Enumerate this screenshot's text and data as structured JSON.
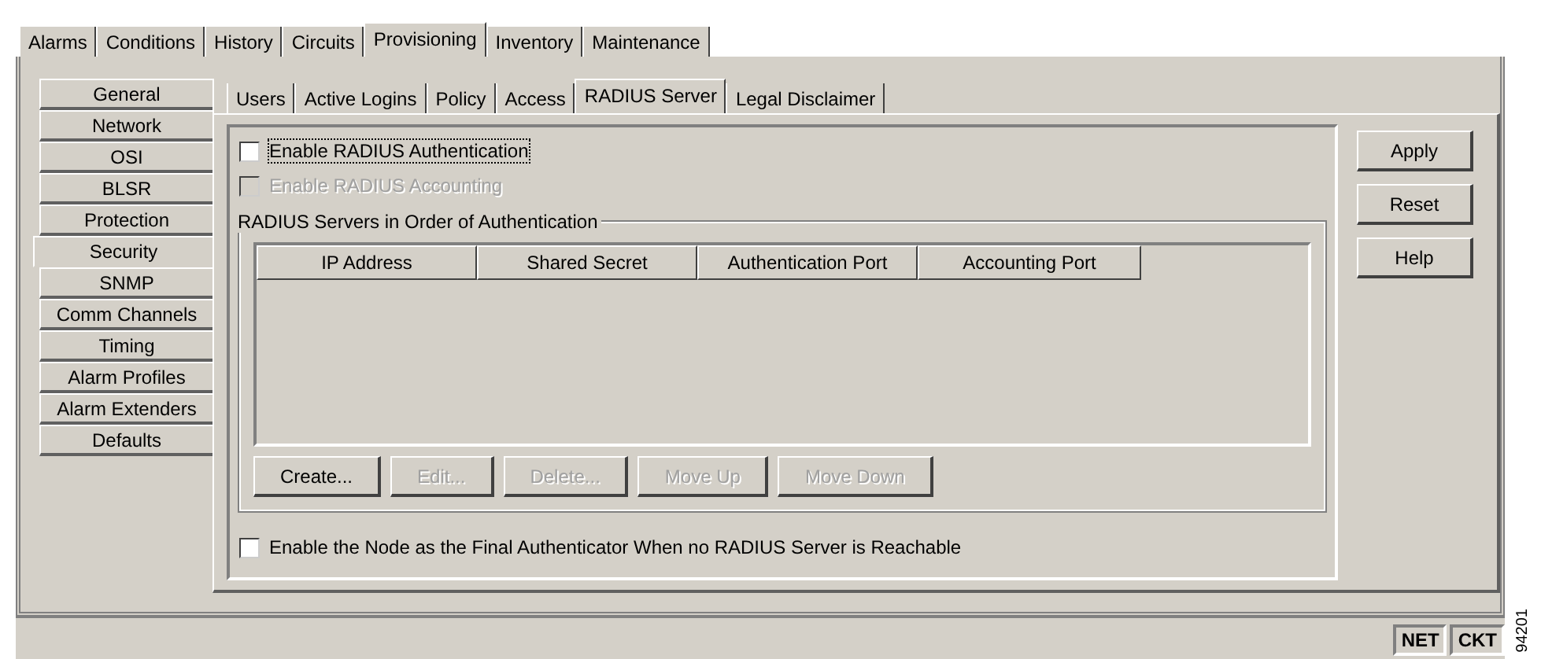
{
  "tabs": [
    {
      "label": "Alarms",
      "selected": false
    },
    {
      "label": "Conditions",
      "selected": false
    },
    {
      "label": "History",
      "selected": false
    },
    {
      "label": "Circuits",
      "selected": false
    },
    {
      "label": "Provisioning",
      "selected": true
    },
    {
      "label": "Inventory",
      "selected": false
    },
    {
      "label": "Maintenance",
      "selected": false
    }
  ],
  "sidebar": {
    "items": [
      {
        "label": "General",
        "selected": false
      },
      {
        "label": "Network",
        "selected": false
      },
      {
        "label": "OSI",
        "selected": false
      },
      {
        "label": "BLSR",
        "selected": false
      },
      {
        "label": "Protection",
        "selected": false
      },
      {
        "label": "Security",
        "selected": true
      },
      {
        "label": "SNMP",
        "selected": false
      },
      {
        "label": "Comm Channels",
        "selected": false
      },
      {
        "label": "Timing",
        "selected": false
      },
      {
        "label": "Alarm Profiles",
        "selected": false
      },
      {
        "label": "Alarm Extenders",
        "selected": false
      },
      {
        "label": "Defaults",
        "selected": false
      }
    ]
  },
  "subtabs": [
    {
      "label": "Users",
      "selected": false
    },
    {
      "label": "Active Logins",
      "selected": false
    },
    {
      "label": "Policy",
      "selected": false
    },
    {
      "label": "Access",
      "selected": false
    },
    {
      "label": "RADIUS Server",
      "selected": true
    },
    {
      "label": "Legal Disclaimer",
      "selected": false
    }
  ],
  "options": [
    {
      "label": "Enable RADIUS Authentication",
      "checked": false,
      "disabled": false,
      "focused": true
    },
    {
      "label": "Enable RADIUS Accounting",
      "checked": false,
      "disabled": true,
      "focused": false
    }
  ],
  "servers_group": {
    "title": "RADIUS Servers in Order of Authentication",
    "table": {
      "columns": [
        "IP Address",
        "Shared Secret",
        "Authentication Port",
        "Accounting Port"
      ]
    },
    "buttons": [
      {
        "label": "Create...",
        "disabled": false
      },
      {
        "label": "Edit...",
        "disabled": true
      },
      {
        "label": "Delete...",
        "disabled": true
      },
      {
        "label": "Move Up",
        "disabled": true
      },
      {
        "label": "Move Down",
        "disabled": true
      }
    ]
  },
  "final_option": {
    "label": "Enable the Node as the Final Authenticator When no RADIUS Server is Reachable",
    "checked": false
  },
  "side_buttons": [
    "Apply",
    "Reset",
    "Help"
  ],
  "status_bar": {
    "indicators": [
      "NET",
      "CKT"
    ]
  },
  "figure_number": "94201"
}
